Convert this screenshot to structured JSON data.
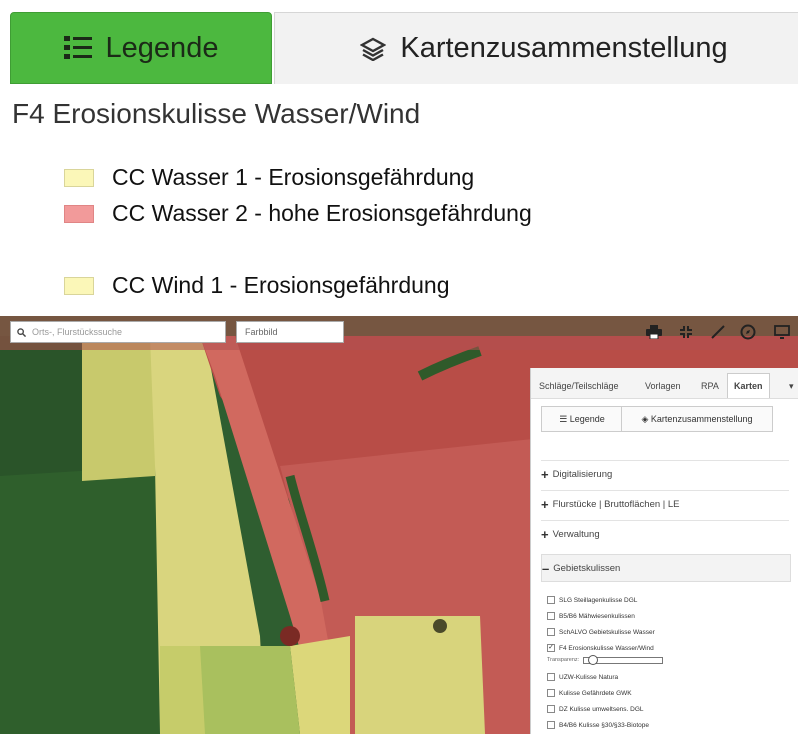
{
  "legend_zoom": {
    "tabs": [
      {
        "label": "Legende",
        "icon": "list-icon",
        "active": true
      },
      {
        "label": "Kartenzusammenstellung",
        "icon": "layers-icon",
        "active": false
      }
    ],
    "heading": "F4 Erosionskulisse Wasser/Wind",
    "items": [
      {
        "label": "CC Wasser 1 - Erosionsgefährdung",
        "color": "#fbf7b8"
      },
      {
        "label": "CC Wasser 2 - hohe Erosionsgefährdung",
        "color": "#f29a9a"
      },
      {
        "label": "CC Wind 1 - Erosionsgefährdung",
        "color": "#fbf7b8"
      }
    ]
  },
  "map": {
    "search_placeholder": "Orts-, Flurstückssuche",
    "basemap_value": "Farbbild",
    "toolbar_icons": [
      "print-icon",
      "collapse-icon",
      "measure-icon",
      "compass-icon",
      "monitor-icon"
    ],
    "colors": {
      "red_overlay": "#c0504d",
      "yellow_overlay": "#e9e58a",
      "dark_green": "#2e5a2f",
      "mid_green": "#4f7d3a"
    }
  },
  "panel": {
    "tabs": [
      "Schläge/Teilschläge",
      "Vorlagen",
      "RPA",
      "Karten"
    ],
    "active_tab": "Karten",
    "subtabs": [
      "Legende",
      "Kartenzusammenstellung"
    ],
    "sections": [
      {
        "label": "Digitalisierung",
        "sign": "+"
      },
      {
        "label": "Flurstücke | Bruttoflächen | LE",
        "sign": "+"
      },
      {
        "label": "Verwaltung",
        "sign": "+"
      },
      {
        "label": "Gebietskulissen",
        "sign": "–"
      }
    ],
    "layers": [
      {
        "label": "SLG Steillagenkulisse DGL",
        "checked": false
      },
      {
        "label": "B5/B6 Mähwiesenkulissen",
        "checked": false
      },
      {
        "label": "SchALVO Gebietskulisse Wasser",
        "checked": false
      },
      {
        "label": "F4 Erosionskulisse Wasser/Wind",
        "checked": true
      },
      {
        "label": "UZW-Kulisse Natura",
        "checked": false
      },
      {
        "label": "Kulisse Gefährdete GWK",
        "checked": false
      },
      {
        "label": "DZ Kulisse umweltsens. DGL",
        "checked": false
      },
      {
        "label": "B4/B6 Kulisse §30/§33-Biotope",
        "checked": false
      }
    ],
    "transparency_label": "Transparenz:",
    "transparency_value": 0.05
  }
}
